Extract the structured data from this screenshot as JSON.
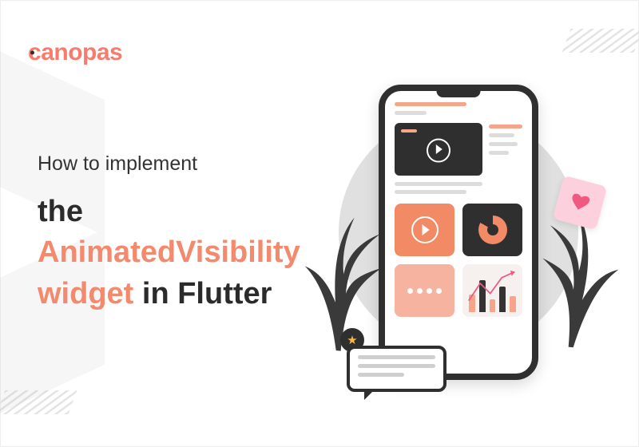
{
  "brand": {
    "name": "canopas"
  },
  "headline": {
    "lead": "How to implement",
    "line1_plain": "the ",
    "line1_accent": "AnimatedVisibility",
    "line2_accent": "widget",
    "line2_plain": " in Flutter"
  },
  "colors": {
    "accent": "#f3896d",
    "brand": "#f77c6e",
    "dark": "#2f2f2f"
  }
}
